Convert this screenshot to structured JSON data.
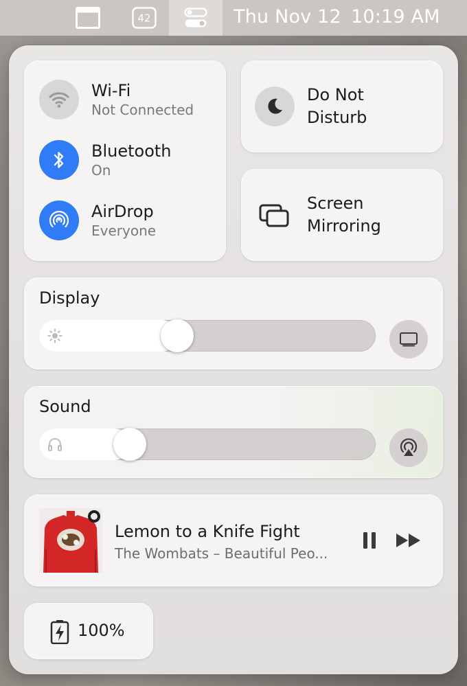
{
  "menubar": {
    "window_icon": "window-icon",
    "badge_number": "42",
    "control_center_icon": "control-center-icon",
    "date": "Thu Nov 12",
    "time": "10:19 AM"
  },
  "network": {
    "wifi": {
      "title": "Wi-Fi",
      "status": "Not Connected",
      "icon": "wifi-icon",
      "enabled": false
    },
    "bluetooth": {
      "title": "Bluetooth",
      "status": "On",
      "icon": "bluetooth-icon",
      "enabled": true
    },
    "airdrop": {
      "title": "AirDrop",
      "status": "Everyone",
      "icon": "airdrop-icon",
      "enabled": true
    }
  },
  "do_not_disturb": {
    "line1": "Do Not",
    "line2": "Disturb",
    "icon": "moon-icon"
  },
  "screen_mirroring": {
    "line1": "Screen",
    "line2": "Mirroring",
    "icon": "screen-mirroring-icon"
  },
  "display": {
    "title": "Display",
    "brightness_percent": 41,
    "icon": "sun-icon",
    "side_icon": "display-icon"
  },
  "sound": {
    "title": "Sound",
    "volume_percent": 27,
    "icon": "headphones-icon",
    "side_icon": "airplay-audio-icon"
  },
  "now_playing": {
    "song": "Lemon to a Knife Fight",
    "artist": "The Wombats – Beautiful Peo...",
    "art_icon": "album-art",
    "pause_icon": "pause-icon",
    "forward_icon": "fast-forward-icon"
  },
  "battery": {
    "percent_label": "100%",
    "icon": "battery-charging-icon"
  },
  "colors": {
    "accent_blue": "#2f7cf6",
    "inactive_gray": "#d8d6d6"
  }
}
